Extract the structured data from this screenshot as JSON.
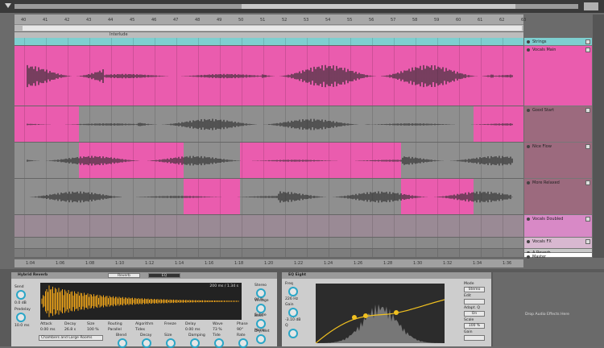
{
  "ruler": {
    "ticks": [
      "40",
      "41",
      "42",
      "43",
      "44",
      "45",
      "46",
      "47",
      "48",
      "49",
      "50",
      "51",
      "52",
      "53",
      "54",
      "55",
      "56",
      "57",
      "58",
      "59",
      "60",
      "61",
      "62",
      "63"
    ]
  },
  "marker": {
    "label": "Interlude"
  },
  "tracks": [
    {
      "name": "Strings",
      "color": "#7ecfd0"
    },
    {
      "name": "Vocals Main",
      "color": "#ea5cae"
    },
    {
      "name": "Good Start",
      "color": "#9c6a7e"
    },
    {
      "name": "Nice Flow",
      "color": "#9c6a7e"
    },
    {
      "name": "More Relaxed",
      "color": "#9c6a7e"
    },
    {
      "name": "Vocals Doubled",
      "color": "#d889c6"
    },
    {
      "name": "Vocals FX",
      "color": "#d8b8d0"
    },
    {
      "name": "A Reverb",
      "color": "#c9c9c9"
    },
    {
      "name": "Master",
      "color": "#ffffff"
    }
  ],
  "bottom_ruler": {
    "ticks": [
      "1:04",
      "1:06",
      "1:08",
      "1:10",
      "1:12",
      "1:14",
      "1:16",
      "1:18",
      "1:20",
      "1:22",
      "1:24",
      "1:26",
      "1:28",
      "1:30",
      "1:32",
      "1:34",
      "1:36"
    ]
  },
  "reverb": {
    "title": "Hybrid Reverb",
    "tabs": [
      "Reverb",
      "EQ"
    ],
    "display_readout": "200 ms / 1.34 s",
    "params": [
      {
        "label": "Send",
        "value": "0.0 dB"
      },
      {
        "label": "Predelay",
        "value": "10.0 ms"
      },
      {
        "label": "Attack",
        "value": "0.00 ms"
      },
      {
        "label": "Decay",
        "value": "26.8 s"
      },
      {
        "label": "Size",
        "value": "100 %"
      },
      {
        "label": "Routing",
        "value": "Parallel"
      },
      {
        "label": "Algorithm",
        "value": "Tides"
      },
      {
        "label": "Freeze",
        "value": ""
      },
      {
        "label": "Delay",
        "value": "0.00 ms"
      },
      {
        "label": "Wave",
        "value": "73 %"
      },
      {
        "label": "Phase",
        "value": "90°"
      }
    ],
    "convolution_ir": "Chambers and Large Rooms",
    "lower_knobs": [
      "Blend",
      "Decay",
      "Size",
      "Damping",
      "Tide",
      "Rate"
    ],
    "right_params": [
      {
        "label": "Stereo",
        "value": "84 %"
      },
      {
        "label": "Vintage",
        "value": "Subtle"
      },
      {
        "label": "Bass",
        "value": "Mono"
      },
      {
        "label": "Dry/Wet",
        "value": ""
      }
    ]
  },
  "eq": {
    "title": "EQ Eight",
    "left_params": [
      {
        "label": "Freq",
        "value": "226 Hz"
      },
      {
        "label": "Gain",
        "value": "-3.10 dB"
      },
      {
        "label": "Q",
        "value": ""
      }
    ],
    "right_params": [
      {
        "label": "Mode",
        "value": "Stereo"
      },
      {
        "label": "Edit",
        "value": ""
      },
      {
        "label": "Adapt. Q",
        "value": "On"
      },
      {
        "label": "Scale",
        "value": "100 %"
      },
      {
        "label": "Gain",
        "value": ""
      }
    ]
  },
  "dropzone": {
    "text": "Drop Audio Effects Here"
  },
  "colors": {
    "pink": "#ea5cae",
    "muted": "#8f8f8f",
    "knob": "#2aa6c7",
    "waveform_orange": "#f0a51a"
  }
}
